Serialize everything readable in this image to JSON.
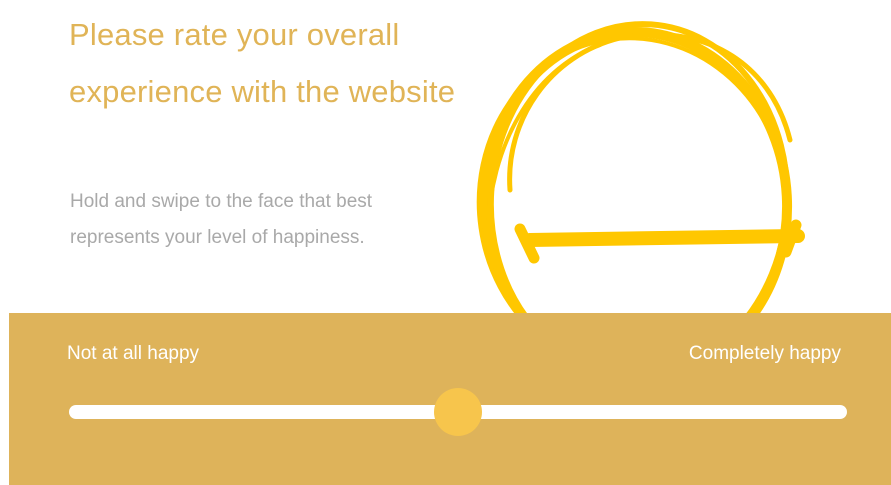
{
  "survey": {
    "question": "Please rate your overall experience with the website",
    "instruction": "Hold and swipe to the face that best represents your level of happiness."
  },
  "face": {
    "icon": "neutral-face-icon",
    "color": "#ffc700"
  },
  "slider": {
    "min_label": "Not at all happy",
    "max_label": "Completely happy",
    "value": 0.5,
    "panel_color": "#deb35a",
    "thumb_color": "#f7c54c",
    "track_color": "#ffffff"
  },
  "colors": {
    "question_text": "#e0b457",
    "instruction_text": "#a9a9a9"
  }
}
